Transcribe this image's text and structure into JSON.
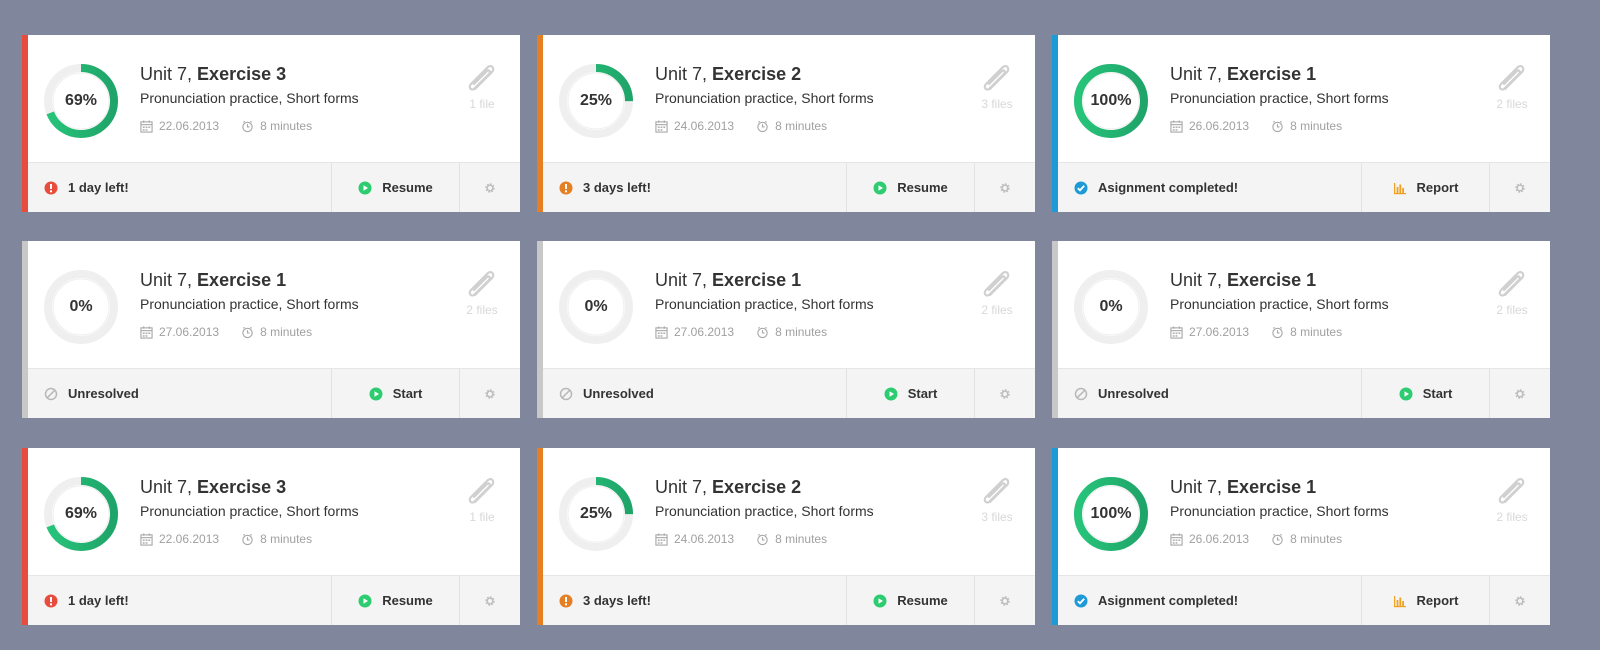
{
  "cards": [
    {
      "percent_label": "69%",
      "progress": 0.69,
      "unit": "Unit 7,",
      "exercise": "Exercise 3",
      "subtitle": "Pronunciation practice, Short forms",
      "date": "22.06.2013",
      "duration": "8 minutes",
      "files": "1 file",
      "status": "1 day left!",
      "status_icon": "alert-icon",
      "action": "Resume",
      "action_icon": "play-icon",
      "accent": "#e74c3c"
    },
    {
      "percent_label": "25%",
      "progress": 0.25,
      "unit": "Unit 7,",
      "exercise": "Exercise 2",
      "subtitle": "Pronunciation practice, Short forms",
      "date": "24.06.2013",
      "duration": "8 minutes",
      "files": "3 files",
      "status": "3 days left!",
      "status_icon": "alert-icon",
      "action": "Resume",
      "action_icon": "play-icon",
      "accent": "#e67e22"
    },
    {
      "percent_label": "100%",
      "progress": 1.0,
      "unit": "Unit 7,",
      "exercise": "Exercise 1",
      "subtitle": "Pronunciation practice, Short forms",
      "date": "26.06.2013",
      "duration": "8 minutes",
      "files": "2 files",
      "status": "Asignment completed!",
      "status_icon": "check-icon",
      "action": "Report",
      "action_icon": "bar-chart-icon",
      "accent": "#1e9ad6"
    },
    {
      "percent_label": "0%",
      "progress": 0,
      "unit": "Unit 7,",
      "exercise": "Exercise 1",
      "subtitle": "Pronunciation practice, Short forms",
      "date": "27.06.2013",
      "duration": "8 minutes",
      "files": "2 files",
      "status": "Unresolved",
      "status_icon": "blocked-icon",
      "action": "Start",
      "action_icon": "play-icon",
      "accent": "#c8c8c8"
    },
    {
      "percent_label": "0%",
      "progress": 0,
      "unit": "Unit 7,",
      "exercise": "Exercise 1",
      "subtitle": "Pronunciation practice, Short forms",
      "date": "27.06.2013",
      "duration": "8 minutes",
      "files": "2 files",
      "status": "Unresolved",
      "status_icon": "blocked-icon",
      "action": "Start",
      "action_icon": "play-icon",
      "accent": "#c8c8c8"
    },
    {
      "percent_label": "0%",
      "progress": 0,
      "unit": "Unit 7,",
      "exercise": "Exercise 1",
      "subtitle": "Pronunciation practice, Short forms",
      "date": "27.06.2013",
      "duration": "8 minutes",
      "files": "2 files",
      "status": "Unresolved",
      "status_icon": "blocked-icon",
      "action": "Start",
      "action_icon": "play-icon",
      "accent": "#c8c8c8"
    },
    {
      "percent_label": "69%",
      "progress": 0.69,
      "unit": "Unit 7,",
      "exercise": "Exercise 3",
      "subtitle": "Pronunciation practice, Short forms",
      "date": "22.06.2013",
      "duration": "8 minutes",
      "files": "1 file",
      "status": "1 day left!",
      "status_icon": "alert-icon",
      "action": "Resume",
      "action_icon": "play-icon",
      "accent": "#e74c3c"
    },
    {
      "percent_label": "25%",
      "progress": 0.25,
      "unit": "Unit 7,",
      "exercise": "Exercise 2",
      "subtitle": "Pronunciation practice, Short forms",
      "date": "24.06.2013",
      "duration": "8 minutes",
      "files": "3 files",
      "status": "3 days left!",
      "status_icon": "alert-icon",
      "action": "Resume",
      "action_icon": "play-icon",
      "accent": "#e67e22"
    },
    {
      "percent_label": "100%",
      "progress": 1.0,
      "unit": "Unit 7,",
      "exercise": "Exercise 1",
      "subtitle": "Pronunciation practice, Short forms",
      "date": "26.06.2013",
      "duration": "8 minutes",
      "files": "2 files",
      "status": "Asignment completed!",
      "status_icon": "check-icon",
      "action": "Report",
      "action_icon": "bar-chart-icon",
      "accent": "#1e9ad6"
    }
  ],
  "colors": {
    "progress": "#27c47a",
    "progress_dark": "#1fa469",
    "track": "#efefef",
    "play": "#2ecc71",
    "report": "#f0a020",
    "gear": "#bdbdbd"
  }
}
